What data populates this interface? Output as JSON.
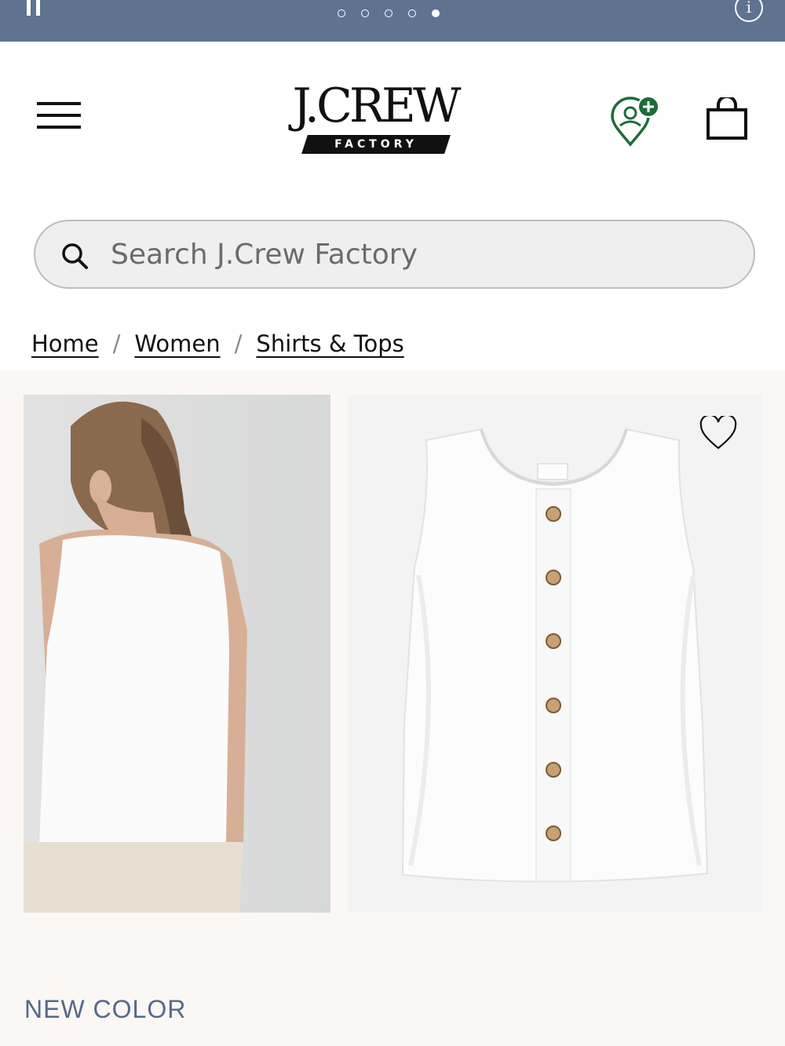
{
  "promo": {
    "slide_count": 5,
    "active_slide": 5,
    "background": "#5f7391",
    "pause_icon": "pause-icon",
    "info_icon": "info-icon",
    "info_glyph": "i"
  },
  "header": {
    "menu_icon": "hamburger-menu-icon",
    "logo": {
      "wordmark": "J.CREW",
      "sub": "FACTORY"
    },
    "store_icon": "store-locator-add-icon",
    "store_accent": "#1e6b3a",
    "bag_icon": "shopping-bag-icon"
  },
  "search": {
    "placeholder": "Search J.Crew Factory",
    "value": "",
    "icon": "search-icon"
  },
  "breadcrumb": {
    "items": [
      "Home",
      "Women",
      "Shirts & Tops"
    ],
    "separator": "/"
  },
  "product": {
    "images": [
      "model-back-view",
      "flat-lay-front-view"
    ],
    "wishlist_icon": "heart-icon",
    "badge": "NEW COLOR",
    "badge_color": "#55698a"
  }
}
